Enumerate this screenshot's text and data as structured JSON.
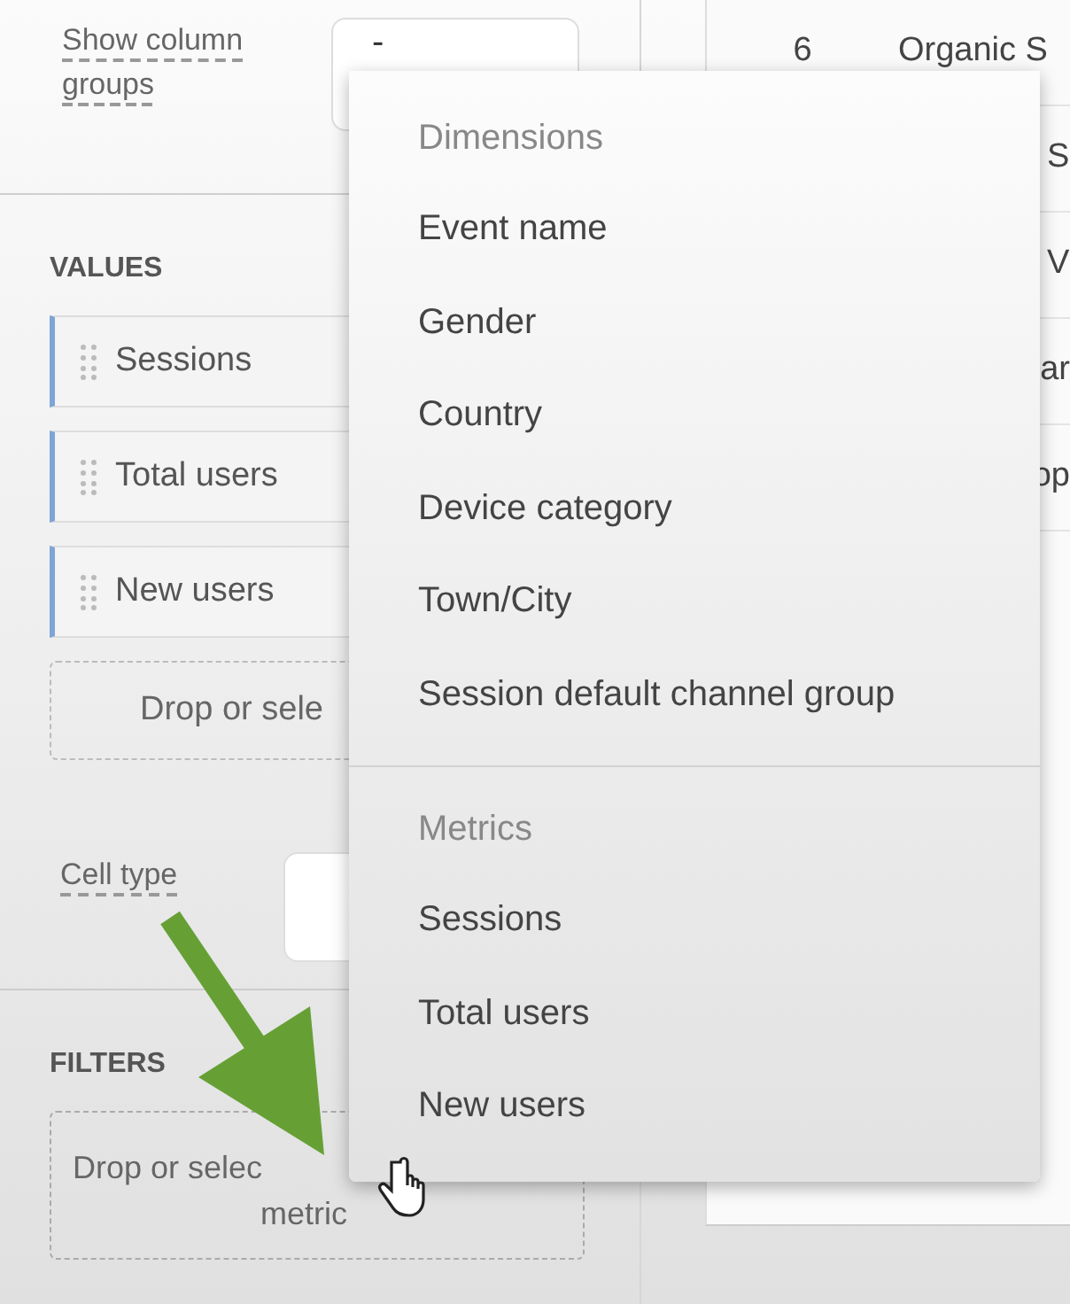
{
  "sidebar": {
    "column_groups": {
      "label": "Show column groups",
      "value": "-"
    },
    "values": {
      "heading": "VALUES",
      "chips": [
        "Sessions",
        "Total users",
        "New users"
      ],
      "drop_zone": "Drop or sele"
    },
    "cell_type": {
      "label": "Cell type"
    },
    "filters": {
      "heading": "FILTERS",
      "drop_zone_lines": [
        "Drop or selec",
        "metric"
      ]
    }
  },
  "table": {
    "rows": [
      {
        "column_1": "6",
        "column_2": "Organic S"
      },
      {
        "column_2": "S"
      },
      {
        "column_2": "V"
      },
      {
        "column_2": "ar"
      },
      {
        "column_2": "op"
      }
    ]
  },
  "menu": {
    "sections": [
      {
        "heading": "Dimensions",
        "items": [
          "Event name",
          "Gender",
          "Country",
          "Device category",
          "Town/City",
          "Session default channel group"
        ]
      },
      {
        "heading": "Metrics",
        "items": [
          "Sessions",
          "Total users",
          "New users"
        ]
      }
    ]
  }
}
